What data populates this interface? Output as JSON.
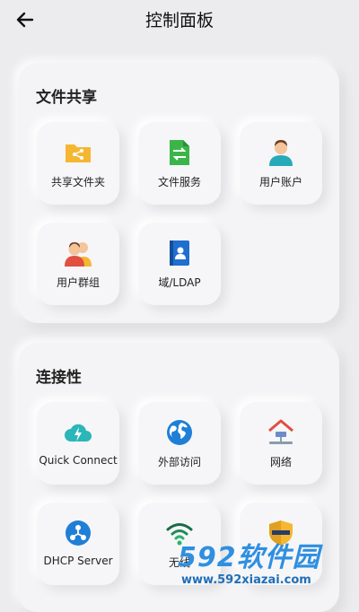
{
  "header": {
    "title": "控制面板"
  },
  "sections": [
    {
      "title": "文件共享",
      "items": [
        {
          "label": "共享文件夹",
          "icon": "shared-folder-icon"
        },
        {
          "label": "文件服务",
          "icon": "file-services-icon"
        },
        {
          "label": "用户账户",
          "icon": "user-account-icon"
        },
        {
          "label": "用户群组",
          "icon": "user-group-icon"
        },
        {
          "label": "域/LDAP",
          "icon": "ldap-directory-icon"
        }
      ]
    },
    {
      "title": "连接性",
      "items": [
        {
          "label": "Quick Connect",
          "icon": "cloud-bolt-icon"
        },
        {
          "label": "外部访问",
          "icon": "globe-icon"
        },
        {
          "label": "网络",
          "icon": "network-house-icon"
        },
        {
          "label": "DHCP Server",
          "icon": "dhcp-icon"
        },
        {
          "label": "无线",
          "icon": "wifi-icon"
        },
        {
          "label": "",
          "icon": "security-shield-icon"
        }
      ]
    }
  ],
  "watermark": {
    "logo": "592软件园",
    "url": "www.592xiazai.com"
  },
  "colors": {
    "accent_blue": "#2f8fe0",
    "folder_yellow": "#f5b731",
    "green": "#3bb54a",
    "red": "#e04f3f"
  }
}
